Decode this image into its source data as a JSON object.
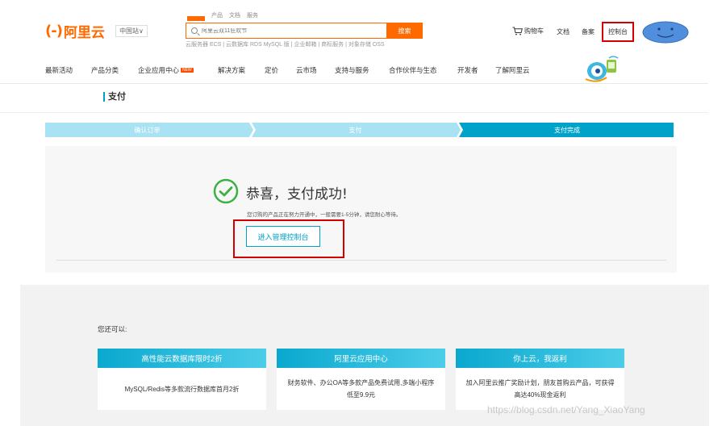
{
  "header": {
    "logo_mark": "(-)",
    "logo_text": "阿里云",
    "region": "中国站∨",
    "search_tabs": [
      "产品",
      "文档",
      "服务"
    ],
    "search_placeholder": "阿里云双11狂欢节",
    "search_button": "搜索",
    "hot_links": "云服务器 ECS | 云数据库 RDS MySQL 版 | 企业邮箱 | 商标服务 | 对象存储 OSS",
    "cart": "购物车",
    "docs": "文档",
    "beian": "备案",
    "console": "控制台"
  },
  "nav": {
    "items": [
      "最新活动",
      "产品分类",
      "企业应用中心",
      "解决方案",
      "定价",
      "云市场",
      "支持与服务",
      "合作伙伴与生态",
      "开发者",
      "了解阿里云"
    ],
    "new_badge": "NEW"
  },
  "sub_header": {
    "title": "支付"
  },
  "steps": [
    "确认订单",
    "支付",
    "支付完成"
  ],
  "success": {
    "title": "恭喜，支付成功!",
    "desc": "您订购的产品正在努力开通中，一般需要1-5分钟，请您耐心等待。",
    "console_button": "进入管理控制台"
  },
  "also": {
    "label": "您还可以:",
    "cards": [
      {
        "head": "高性能云数据库限时2折",
        "body": "MySQL/Redis等多款流行数据库首月2折"
      },
      {
        "head": "阿里云应用中心",
        "body": "财务软件、办公OA等多款产品免费试用,多端小程序低至9.9元"
      },
      {
        "head": "你上云，我返利",
        "body": "加入阿里云推广奖励计划，朋友首购云产品，可获得高达40%现金返利"
      }
    ]
  },
  "watermark": "https://blog.csdn.net/Yang_XiaoYang",
  "colors": {
    "brand": "#ff6a00",
    "accent": "#00a2ca",
    "highlight": "#d40000"
  }
}
